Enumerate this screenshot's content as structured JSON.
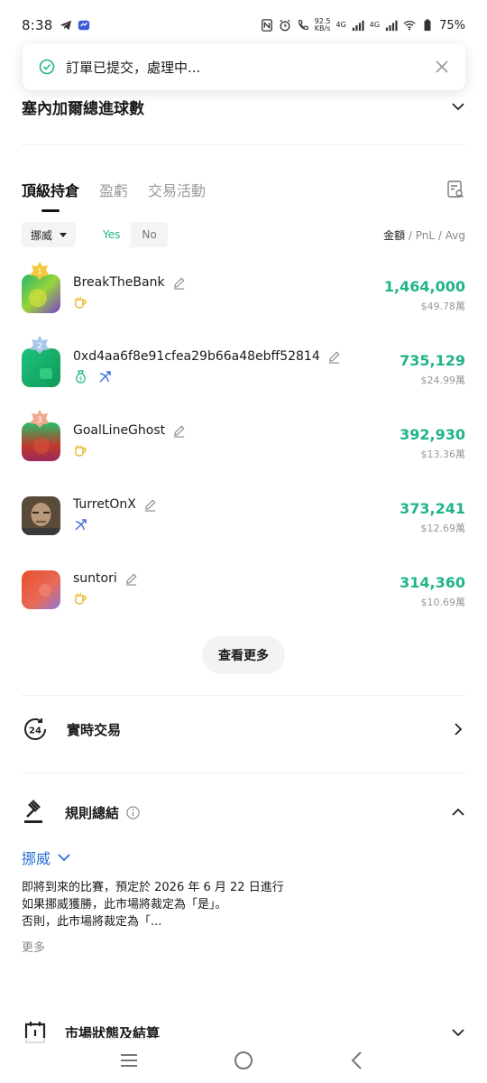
{
  "status_bar": {
    "time": "8:38",
    "speed_value": "92.5",
    "speed_unit": "KB/s",
    "network_1": "4G",
    "network_2": "4G",
    "battery": "75%"
  },
  "toast": {
    "message": "訂單已提交，處理中..."
  },
  "market_question": {
    "label": "塞內加爾總進球數"
  },
  "tabs": [
    {
      "label": "頂級持倉",
      "active": true
    },
    {
      "label": "盈虧",
      "active": false
    },
    {
      "label": "交易活動",
      "active": false
    }
  ],
  "filters": {
    "country": "挪威",
    "yes_label": "Yes",
    "no_label": "No",
    "selected": "Yes",
    "sort_primary": "金額",
    "sort_rest": " / PnL / Avg"
  },
  "holders": [
    {
      "rank": "1",
      "name": "BreakTheBank",
      "amount": "1,464,000",
      "sub": "$49.78萬",
      "icons": [
        "cup-icon"
      ]
    },
    {
      "rank": "2",
      "name": "0xd4aa6f8e91cfea29b66a48ebff52814",
      "amount": "735,129",
      "sub": "$24.99萬",
      "icons": [
        "money-bag-icon",
        "archer-icon"
      ]
    },
    {
      "rank": "3",
      "name": "GoalLineGhost",
      "amount": "392,930",
      "sub": "$13.36萬",
      "icons": [
        "cup-icon"
      ]
    },
    {
      "rank": "",
      "name": "TurretOnX",
      "amount": "373,241",
      "sub": "$12.69萬",
      "icons": [
        "archer-icon"
      ]
    },
    {
      "rank": "",
      "name": "suntori",
      "amount": "314,360",
      "sub": "$10.69萬",
      "icons": [
        "cup-icon"
      ]
    }
  ],
  "see_more": "查看更多",
  "live_trading": {
    "label": "實時交易",
    "badge": "24"
  },
  "rules": {
    "title": "規則總結",
    "country": "挪威",
    "line1": "即將到來的比賽，預定於 2026 年 6 月 22 日進行",
    "line2": "如果挪威獲勝，此市場將裁定為「是」。",
    "line3": "否則，此市場將裁定為「...",
    "more": "更多"
  },
  "market_status": {
    "label": "市場狀態及結算"
  },
  "colors": {
    "accent_green": "#1fb48a",
    "link_blue": "#2a6fd6",
    "gold": "#e8b824",
    "blue_icon": "#3a6fd8"
  }
}
